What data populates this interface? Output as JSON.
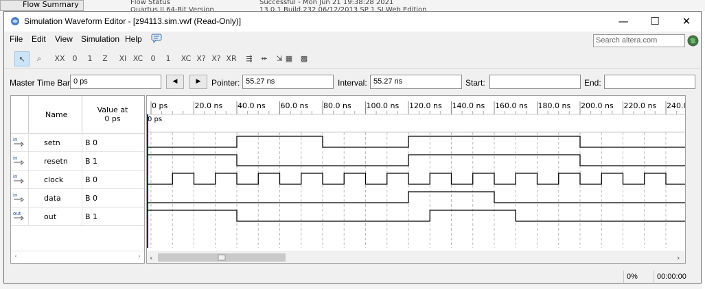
{
  "background": {
    "flow_summary": "Flow Summary",
    "flow_status_label": "Flow Status",
    "flow_status_value": "Successful - Mon Jun 21 19:38:28 2021",
    "version_label": "Quartus II 64-Bit Version",
    "version_value": "13.0.1 Build 232 06/12/2013 SP 1 SJ Web Edition"
  },
  "window": {
    "title": "Simulation Waveform Editor - [z94113.sim.vwf (Read-Only)]",
    "controls": {
      "minimize": "—",
      "maximize": "☐",
      "close": "✕"
    }
  },
  "menu": {
    "items": [
      "File",
      "Edit",
      "View",
      "Simulation",
      "Help"
    ]
  },
  "search": {
    "placeholder": "Search altera.com"
  },
  "toolbar": {
    "icons": [
      "pointer-tool-icon",
      "zoom-tool-icon",
      "uninitialized-icon",
      "force-low-icon",
      "force-high-icon",
      "high-impedance-icon",
      "invert-icon",
      "count-value-icon",
      "weak-low-icon",
      "weak-high-icon",
      "overwrite-clock-icon",
      "random-values-icon",
      "dont-care-icon",
      "arbitrary-value-icon",
      "insert-node-icon",
      "remove-node-icon",
      "assign-value-icon",
      "snap-to-grid-icon",
      "grid-settings-icon"
    ]
  },
  "time_bar": {
    "master_label": "Master Time Bar:",
    "master_value": "0 ps",
    "pointer_label": "Pointer:",
    "pointer_value": "55.27 ns",
    "interval_label": "Interval:",
    "interval_value": "55.27 ns",
    "start_label": "Start:",
    "start_value": "",
    "end_label": "End:",
    "end_value": ""
  },
  "signal_table": {
    "name_header": "Name",
    "value_header_line1": "Value at",
    "value_header_line2": "0 ps",
    "signals": [
      {
        "type": "in",
        "name": "setn",
        "value": "B 0"
      },
      {
        "type": "in",
        "name": "resetn",
        "value": "B 1"
      },
      {
        "type": "in",
        "name": "clock",
        "value": "B 0"
      },
      {
        "type": "in",
        "name": "data",
        "value": "B 0"
      },
      {
        "type": "out",
        "name": "out",
        "value": "B 1"
      }
    ]
  },
  "waveform": {
    "time_labels": [
      "0 ps",
      "20.0 ns",
      "40.0 ns",
      "60.0 ns",
      "80.0 ns",
      "100.0 ns",
      "120.0 ns",
      "140.0 ns",
      "160.0 ns",
      "180.0 ns",
      "200.0 ns",
      "220.0 ns",
      "240.0 ns"
    ],
    "cursor_label": "0 ps",
    "time_end_ns": 250,
    "transitions_ns": {
      "setn": {
        "init": 0,
        "edges": [
          40,
          80,
          120,
          200
        ]
      },
      "resetn": {
        "init": 1,
        "edges": [
          40,
          120,
          200
        ]
      },
      "clock": {
        "init": 0,
        "edges": [
          10,
          20,
          30,
          40,
          50,
          60,
          70,
          80,
          90,
          100,
          110,
          120,
          130,
          140,
          150,
          160,
          170,
          180,
          190,
          200,
          210,
          220,
          230,
          240
        ]
      },
      "data": {
        "init": 0,
        "edges": [
          120,
          160
        ]
      },
      "out": {
        "init": 1,
        "edges": [
          40,
          130,
          170
        ]
      }
    }
  },
  "status": {
    "progress": "0%",
    "elapsed": "00:00:00"
  },
  "colors": {
    "accent": "#0078d7",
    "waveform_line": "#000000",
    "cursor": "#0000c0"
  }
}
